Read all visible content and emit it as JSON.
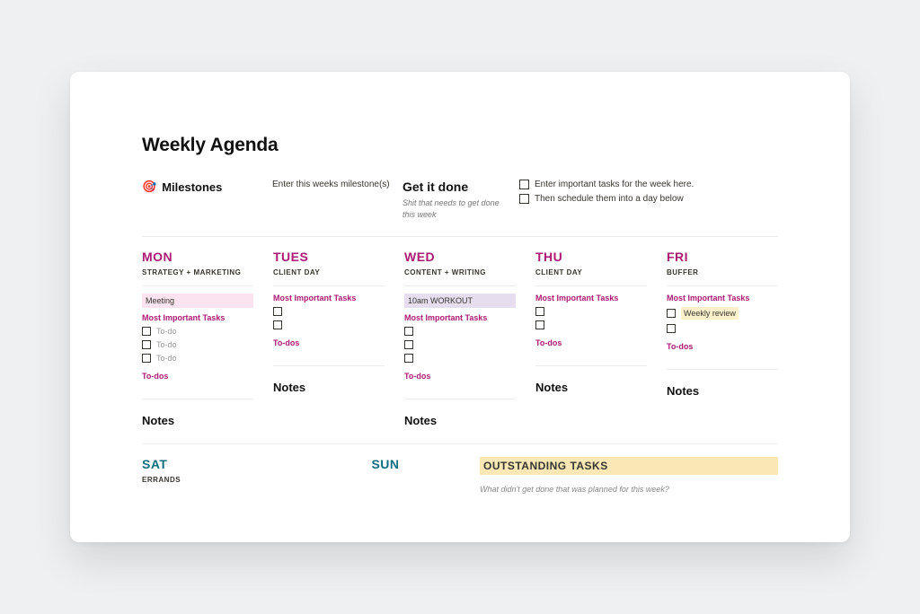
{
  "title": "Weekly Agenda",
  "milestones": {
    "icon": "🎯",
    "heading": "Milestones",
    "placeholder": "Enter this weeks milestone(s)"
  },
  "getitdone": {
    "heading": "Get it done",
    "subtitle": "Shit that needs to get done this week",
    "tasks": [
      "Enter important tasks for the week here.",
      "Then schedule them into a day below"
    ]
  },
  "labels": {
    "mit": "Most Important Tasks",
    "todos": "To-dos",
    "notes": "Notes",
    "todo_placeholder": "To-do"
  },
  "days": [
    {
      "name": "MON",
      "subtitle": "STRATEGY + MARKETING",
      "highlight": {
        "text": "Meeting",
        "color": "pink"
      },
      "tasks": [
        "To-do",
        "To-do",
        "To-do"
      ],
      "color": "pink",
      "notes_offset": true
    },
    {
      "name": "TUES",
      "subtitle": "CLIENT DAY",
      "highlight": null,
      "tasks": [
        "",
        ""
      ],
      "color": "pink",
      "notes_offset": false
    },
    {
      "name": "WED",
      "subtitle": "CONTENT + WRITING",
      "highlight": {
        "text": "10am WORKOUT",
        "color": "purple"
      },
      "tasks": [
        "",
        "",
        ""
      ],
      "color": "pink",
      "notes_offset": true
    },
    {
      "name": "THU",
      "subtitle": "CLIENT DAY",
      "highlight": null,
      "tasks": [
        "",
        ""
      ],
      "color": "pink",
      "notes_offset": false
    },
    {
      "name": "FRI",
      "subtitle": "BUFFER",
      "highlight": null,
      "tasks_highlight": {
        "text": "Weekly review",
        "color": "yellow"
      },
      "tasks": [
        "Weekly review",
        ""
      ],
      "color": "pink",
      "notes_offset": false
    }
  ],
  "weekend": [
    {
      "name": "SAT",
      "subtitle": "ERRANDS"
    },
    {
      "name": "SUN",
      "subtitle": ""
    }
  ],
  "outstanding": {
    "title": "OUTSTANDING TASKS",
    "subtitle": "What didn't get done that was planned for this week?"
  }
}
